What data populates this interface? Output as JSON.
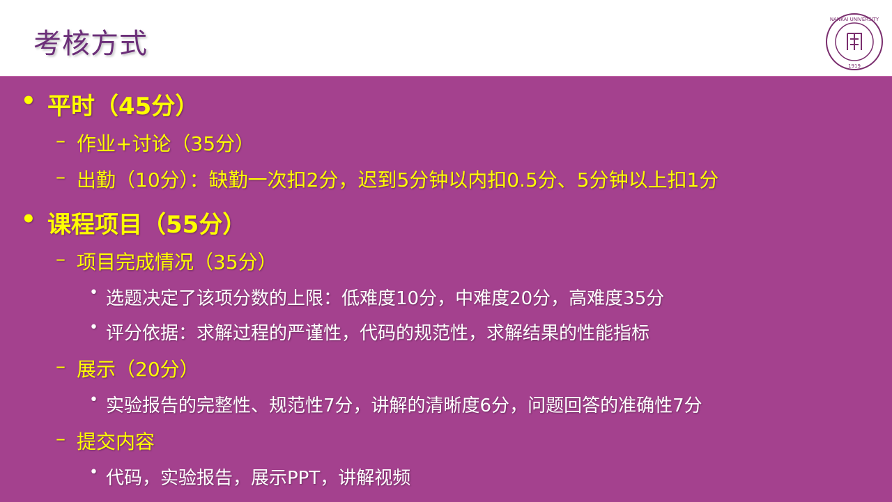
{
  "slide": {
    "title": "考核方式",
    "logo_text": "NANKAI UNIVERSITY",
    "logo_year": "1919",
    "items": [
      {
        "level": 1,
        "text": "平时（45分）"
      },
      {
        "level": 2,
        "text": "作业+讨论（35分）"
      },
      {
        "level": 2,
        "text": "出勤（10分）：缺勤一次扣2分，迟到5分钟以内扣0.5分、5分钟以上扣1分"
      },
      {
        "level": 1,
        "text": "课程项目（55分）"
      },
      {
        "level": 2,
        "text": "项目完成情况（35分）"
      },
      {
        "level": 3,
        "text": "选题决定了该项分数的上限：低难度10分，中难度20分，高难度35分"
      },
      {
        "level": 3,
        "text": "评分依据：求解过程的严谨性，代码的规范性，求解结果的性能指标"
      },
      {
        "level": 2,
        "text": "展示（20分）"
      },
      {
        "level": 3,
        "text": "实验报告的完整性、规范性7分，讲解的清晰度6分，问题回答的准确性7分"
      },
      {
        "level": 2,
        "text": "提交内容"
      },
      {
        "level": 3,
        "text": "代码，实验报告，展示PPT，讲解视频"
      }
    ]
  },
  "markers": {
    "l1": "•",
    "l2": "–",
    "l3": "•"
  },
  "colors": {
    "header_title": "#6b2e78",
    "content_bg": "#a4418e",
    "yellow_text": "#ffff00",
    "white_text": "#ffffff"
  }
}
